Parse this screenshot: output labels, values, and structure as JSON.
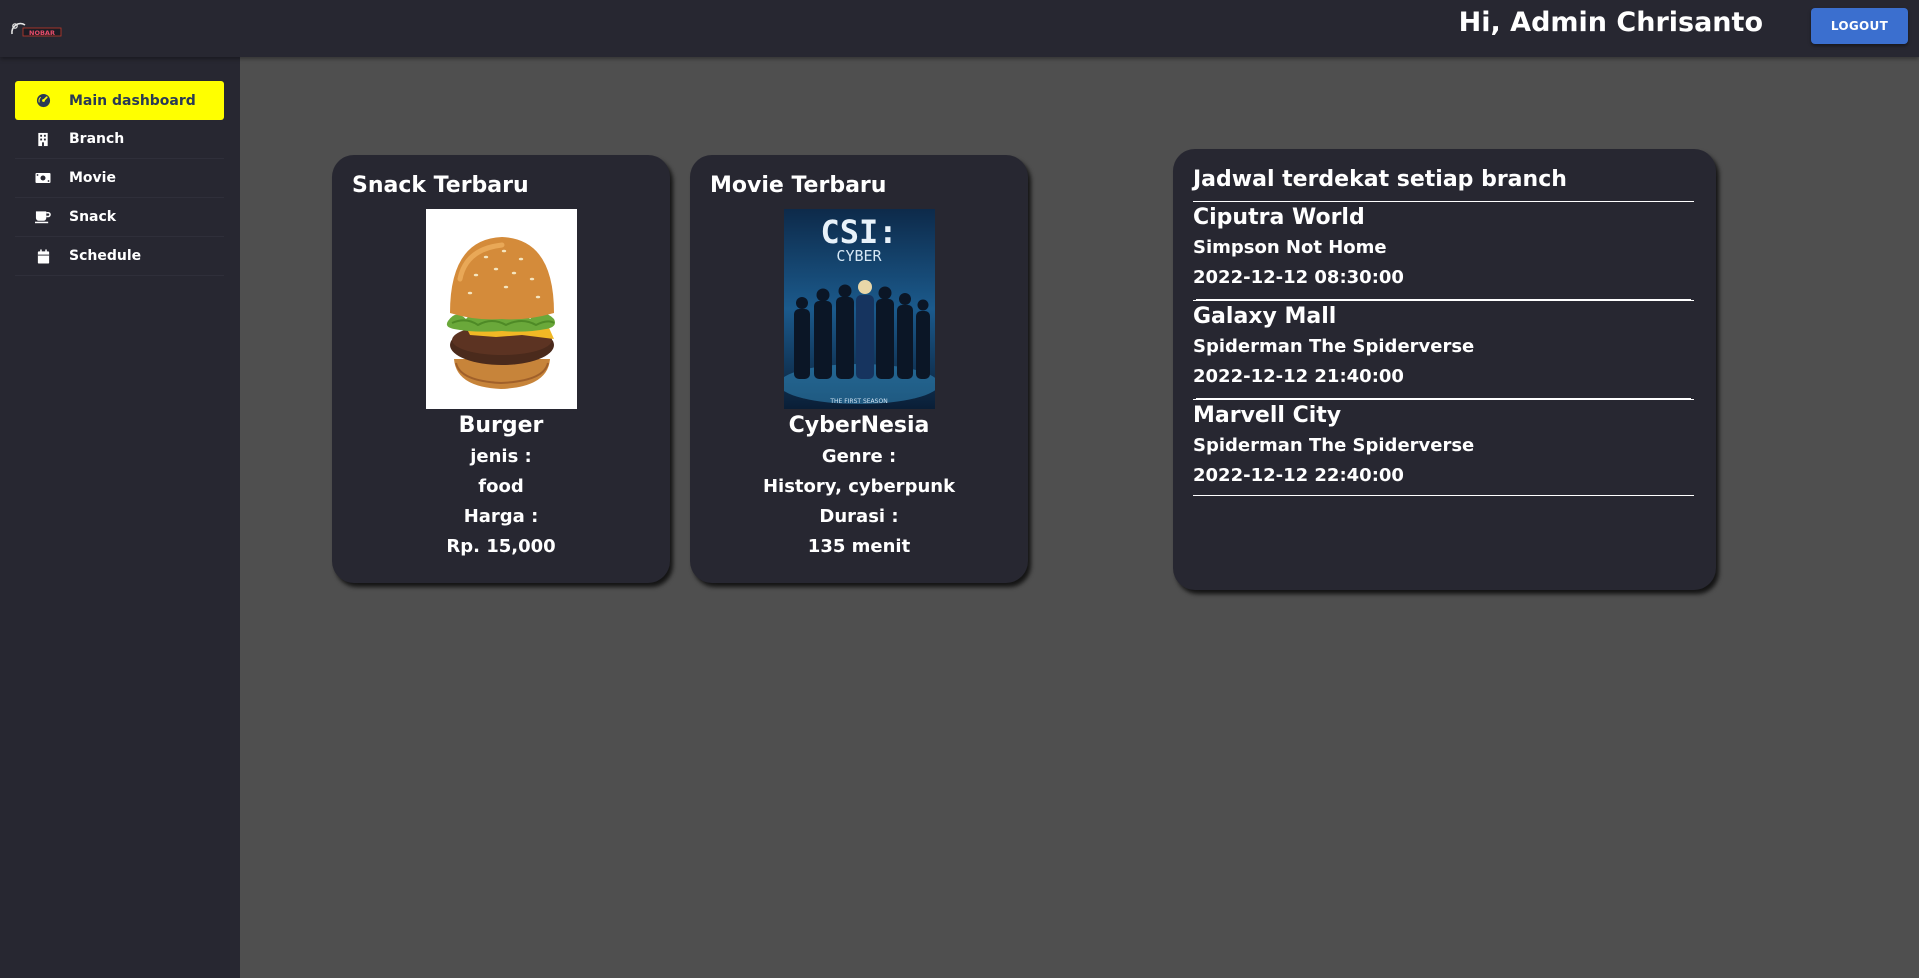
{
  "header": {
    "logo_text": "NOBAR",
    "greeting": "Hi, Admin Chrisanto",
    "logout_label": "LOGOUT"
  },
  "sidebar": {
    "items": [
      {
        "label": "Main dashboard",
        "icon": "dashboard-icon",
        "active": true
      },
      {
        "label": "Branch",
        "icon": "building-icon",
        "active": false
      },
      {
        "label": "Movie",
        "icon": "ticket-icon",
        "active": false
      },
      {
        "label": "Snack",
        "icon": "mug-icon",
        "active": false
      },
      {
        "label": "Schedule",
        "icon": "calendar-icon",
        "active": false
      }
    ]
  },
  "snack_card": {
    "title": "Snack Terbaru",
    "name": "Burger",
    "type_label": "jenis :",
    "type_value": "food",
    "price_label": "Harga :",
    "price_value": "Rp. 15,000"
  },
  "movie_card": {
    "title": "Movie Terbaru",
    "poster_title": "CSI:",
    "poster_subtitle": "CYBER",
    "poster_caption": "THE FIRST SEASON",
    "name": "CyberNesia",
    "genre_label": "Genre :",
    "genre_value": "History, cyberpunk",
    "duration_label": "Durasi :",
    "duration_value": "135 menit"
  },
  "schedule_card": {
    "title": "Jadwal terdekat setiap branch",
    "entries": [
      {
        "branch": "Ciputra World",
        "movie": "Simpson Not Home",
        "time": "2022-12-12 08:30:00"
      },
      {
        "branch": "Galaxy Mall",
        "movie": "Spiderman The Spiderverse",
        "time": "2022-12-12 21:40:00"
      },
      {
        "branch": "Marvell City",
        "movie": "Spiderman The Spiderverse",
        "time": "2022-12-12 22:40:00"
      }
    ]
  },
  "colors": {
    "background": "#4f4f4f",
    "panel": "#272731",
    "active_nav": "#ffff00",
    "logout_button": "#3b6fcf"
  }
}
